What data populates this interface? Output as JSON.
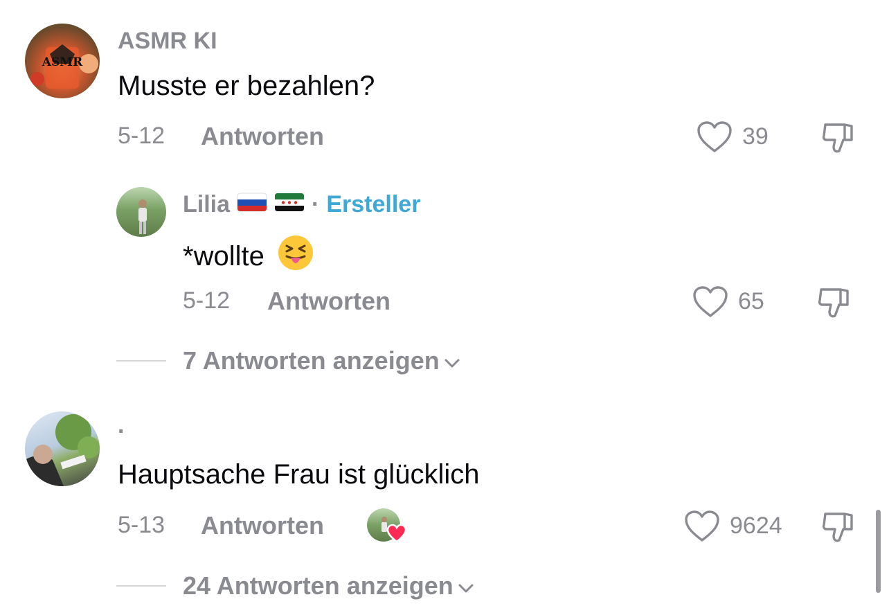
{
  "comments": [
    {
      "username": "ASMR KI",
      "avatar_text": "ASMR",
      "text": "Musste er bezahlen?",
      "date": "5-12",
      "reply_label": "Antworten",
      "likes": "39",
      "reply": {
        "username": "Lilia",
        "separator": "·",
        "badge": "Ersteller",
        "text": "*wollte",
        "date": "5-12",
        "reply_label": "Antworten",
        "likes": "65"
      },
      "view_replies": "7 Antworten anzeigen"
    },
    {
      "username": "·",
      "text": "Hauptsache Frau ist glücklich",
      "date": "5-13",
      "reply_label": "Antworten",
      "likes": "9624",
      "view_replies": "24 Antworten anzeigen"
    }
  ],
  "icons": [
    "heart-icon",
    "dislike-icon",
    "chevron-down-icon",
    "flag-russia-icon",
    "flag-syria-icon",
    "tongue-emoji-icon",
    "creator-liked-heart-icon"
  ],
  "colors": {
    "creator": "#3fa8d6",
    "muted": "#8a8b91",
    "like_badge": "#fe2c55"
  }
}
